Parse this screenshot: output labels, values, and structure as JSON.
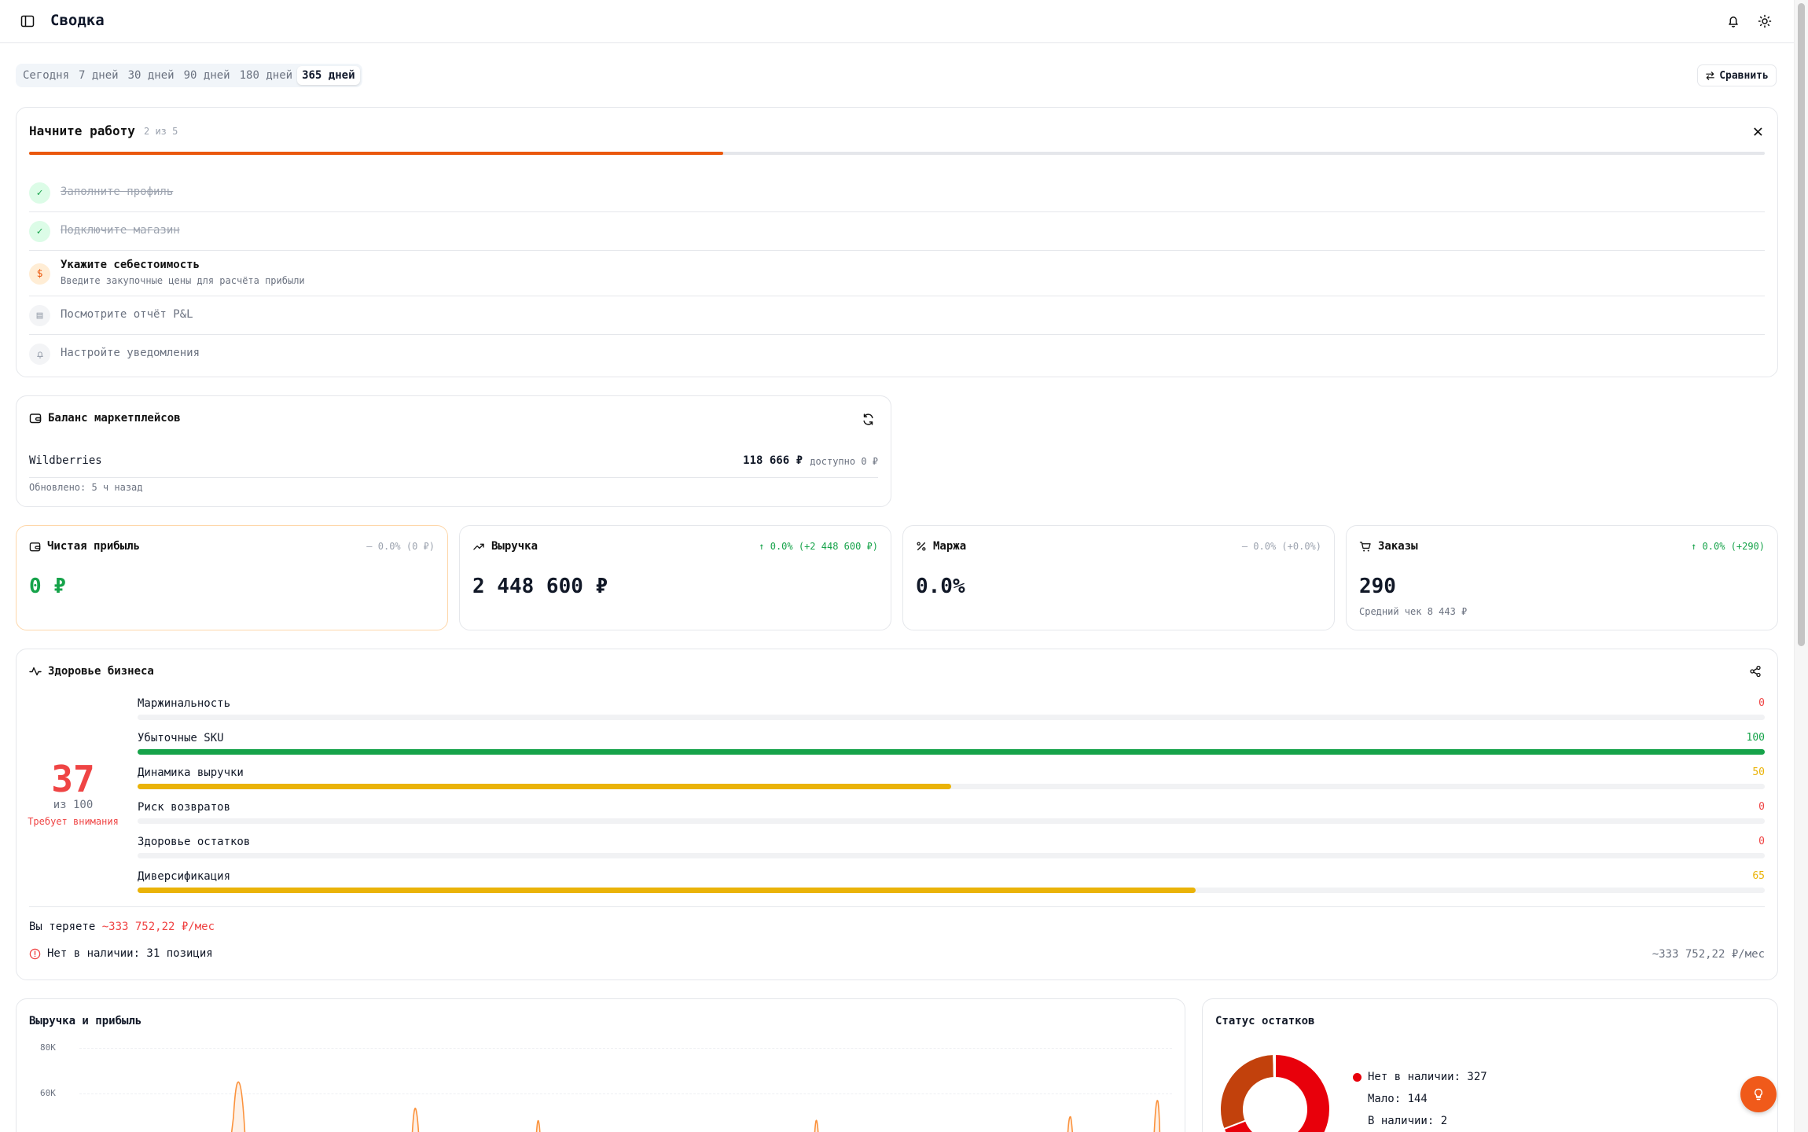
{
  "header": {
    "title": "Сводка"
  },
  "periods": [
    "Сегодня",
    "7 дней",
    "30 дней",
    "90 дней",
    "180 дней",
    "365 дней"
  ],
  "active_period": "365 дней",
  "compare_label": "Сравнить",
  "onboarding": {
    "title": "Начните работу",
    "counter": "2 из 5",
    "progress": 0.4,
    "steps": [
      {
        "label": "Заполните профиль",
        "status": "done"
      },
      {
        "label": "Подключите магазин",
        "status": "done"
      },
      {
        "label": "Укажите себестоимость",
        "sub": "Введите закупочные цены для расчёта прибыли",
        "status": "current"
      },
      {
        "label": "Посмотрите отчёт P&L",
        "status": "todo"
      },
      {
        "label": "Настройте уведомления",
        "status": "todo"
      }
    ]
  },
  "balance": {
    "title": "Баланс маркетплейсов",
    "name": "Wildberries",
    "amount": "118 666 ₽",
    "available": "доступно 0 ₽",
    "updated": "Обновлено: 5 ч назад"
  },
  "kpis": [
    {
      "title": "Чистая прибыль",
      "value": "0 ₽",
      "delta": "— 0.0% (0 ₽)",
      "sub": ""
    },
    {
      "title": "Выручка",
      "value": "2 448 600 ₽",
      "delta": "↑ 0.0% (+2 448 600 ₽)",
      "sub": ""
    },
    {
      "title": "Маржа",
      "value": "0.0%",
      "delta": "— 0.0% (+0.0%)",
      "sub": ""
    },
    {
      "title": "Заказы",
      "value": "290",
      "delta": "↑ 0.0% (+290)",
      "sub": "Средний чек 8 443 ₽"
    }
  ],
  "health": {
    "title": "Здоровье бизнеса",
    "score": "37",
    "of": "из 100",
    "status": "Требует внимания",
    "metrics": [
      {
        "name": "Маржинальность",
        "value": 0
      },
      {
        "name": "Убыточные SKU",
        "value": 100
      },
      {
        "name": "Динамика выручки",
        "value": 50
      },
      {
        "name": "Риск возвратов",
        "value": 0
      },
      {
        "name": "Здоровье остатков",
        "value": 0
      },
      {
        "name": "Диверсификация",
        "value": 65
      }
    ],
    "loss_prefix": "Вы теряете",
    "loss_value": "~333 752,22 ₽/мес",
    "alert": "Нет в наличии: 31 позиция",
    "alert_value": "~333 752,22 ₽/мес"
  },
  "revenue_chart": {
    "title": "Выручка и прибыль",
    "yticks": [
      "80K",
      "60K"
    ]
  },
  "stock": {
    "title": "Статус остатков",
    "legend": [
      {
        "label": "Нет в наличии: 327",
        "value": 327,
        "color": "#e8000b"
      },
      {
        "label": "Мало: 144",
        "value": 144,
        "color": "#c2410c"
      },
      {
        "label": "В наличии: 2",
        "value": 2,
        "color": "#16a34a"
      }
    ]
  },
  "colors": {
    "accent": "#ea580c",
    "green": "#16a34a",
    "red": "#ef4444",
    "amber": "#eab308"
  }
}
